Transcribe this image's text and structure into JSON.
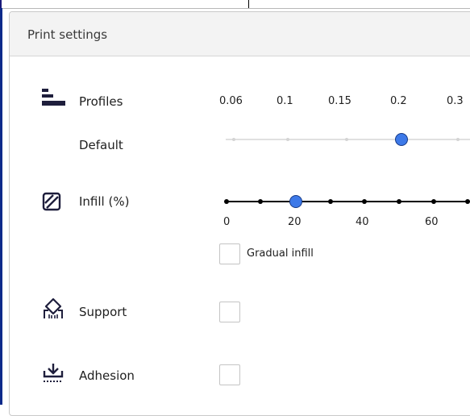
{
  "panel": {
    "title": "Print settings"
  },
  "profiles": {
    "label": "Profiles",
    "sub_label": "Default",
    "icon": "profiles-layers-icon",
    "ticks": [
      "0.06",
      "0.1",
      "0.15",
      "0.2",
      "0.3"
    ],
    "selected": "0.2"
  },
  "infill": {
    "label": "Infill (%)",
    "icon": "infill-hatch-icon",
    "ticks": [
      "0",
      "20",
      "40",
      "60"
    ],
    "value": 20,
    "gradual_label": "Gradual infill",
    "gradual_checked": false
  },
  "support": {
    "label": "Support",
    "icon": "support-icon",
    "checked": false
  },
  "adhesion": {
    "label": "Adhesion",
    "icon": "adhesion-icon",
    "checked": false
  },
  "colors": {
    "accent": "#3d79e8",
    "handle_border": "#173a86",
    "track_active": "#000000",
    "track_inactive": "#e0e0e0"
  }
}
